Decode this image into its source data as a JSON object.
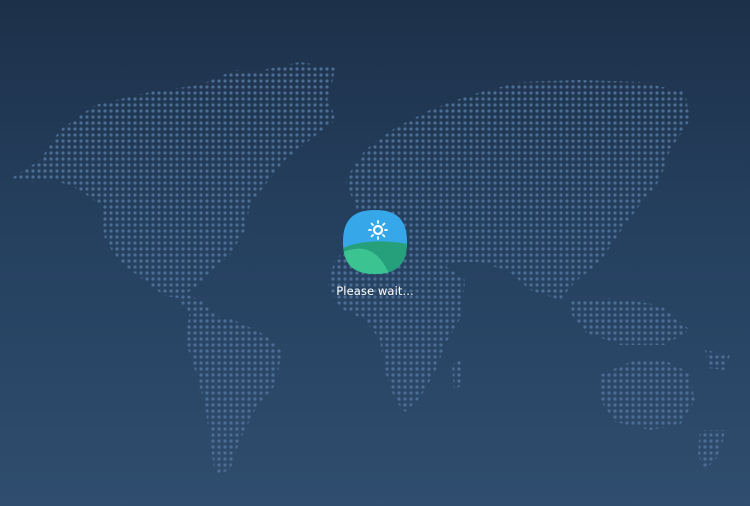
{
  "screen": {
    "background_top": "#1d3049",
    "background_bottom": "#2f4d6e",
    "map_dot_color": "#4d6e94"
  },
  "app_icon": {
    "name": "weather-landscape-icon",
    "sky_color": "#36a8ea",
    "hill_back_color": "#26a07a",
    "hill_front_color": "#3cc392",
    "sun_color": "#ffffff"
  },
  "loading": {
    "message": "Please wait..."
  }
}
